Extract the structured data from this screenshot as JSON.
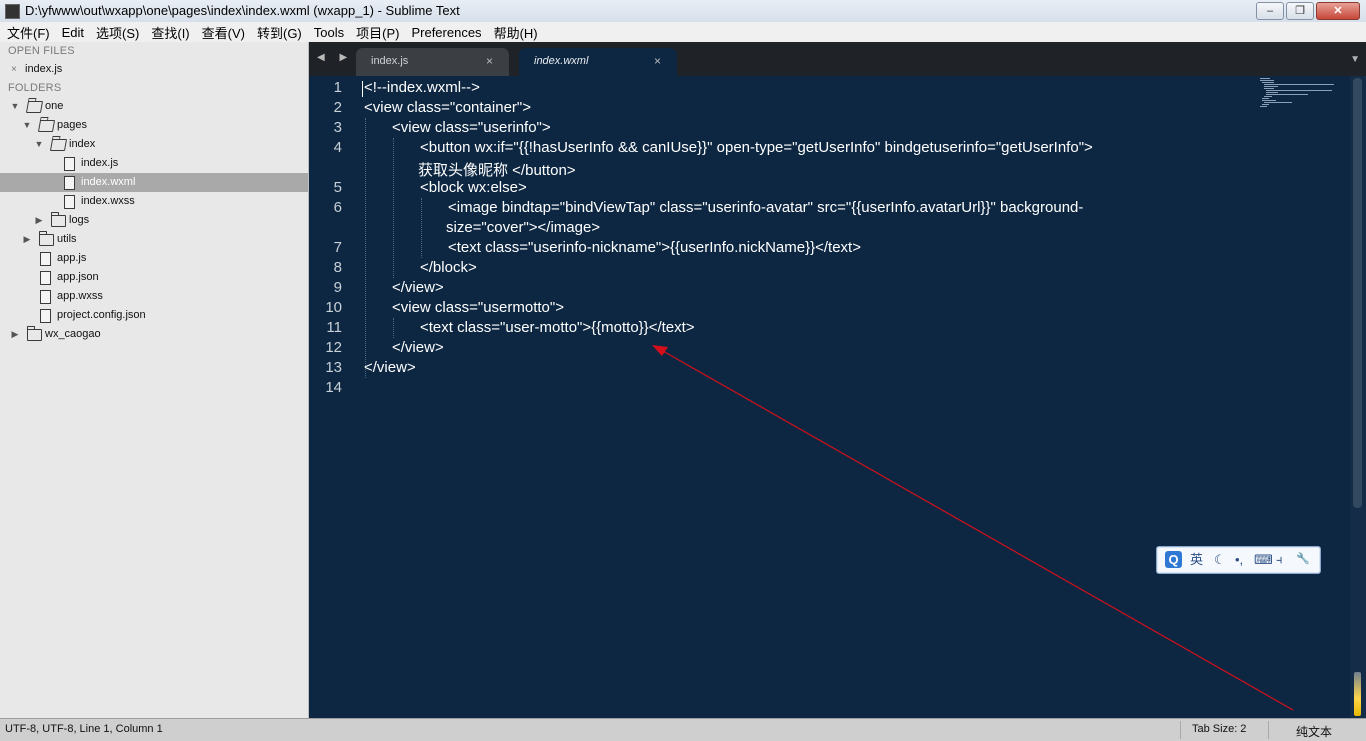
{
  "window": {
    "title": "D:\\yfwww\\out\\wxapp\\one\\pages\\index\\index.wxml (wxapp_1) - Sublime Text",
    "minimize": "‒",
    "maximize": "❐",
    "close": "✕"
  },
  "menu": [
    "文件(F)",
    "Edit",
    "选项(S)",
    "查找(I)",
    "查看(V)",
    "转到(G)",
    "Tools",
    "项目(P)",
    "Preferences",
    "帮助(H)"
  ],
  "sidebar": {
    "open_files_header": "OPEN FILES",
    "open_files": [
      {
        "close": "×",
        "name": "index.js"
      }
    ],
    "folders_header": "FOLDERS",
    "tree": [
      {
        "name": "one",
        "type": "folder",
        "expanded": true
      },
      {
        "name": "pages",
        "type": "folder",
        "expanded": true
      },
      {
        "name": "index",
        "type": "folder",
        "expanded": true
      },
      {
        "name": "index.js",
        "type": "file"
      },
      {
        "name": "index.wxml",
        "type": "file",
        "selected": true
      },
      {
        "name": "index.wxss",
        "type": "file"
      },
      {
        "name": "logs",
        "type": "folder",
        "expanded": false
      },
      {
        "name": "utils",
        "type": "folder",
        "expanded": false
      },
      {
        "name": "app.js",
        "type": "file"
      },
      {
        "name": "app.json",
        "type": "file"
      },
      {
        "name": "app.wxss",
        "type": "file"
      },
      {
        "name": "project.config.json",
        "type": "file"
      },
      {
        "name": "wx_caogao",
        "type": "folder",
        "expanded": false
      }
    ]
  },
  "tabs": [
    {
      "label": "index.js",
      "close": "×",
      "active": false
    },
    {
      "label": "index.wxml",
      "close": "×",
      "active": true
    }
  ],
  "tab_nav": "◀ ▶",
  "tab_menu": "▼",
  "editor": {
    "line_numbers": [
      "1",
      "2",
      "3",
      "4",
      "5",
      "6",
      "7",
      "8",
      "9",
      "10",
      "11",
      "12",
      "13",
      "14"
    ],
    "lines": [
      "<!--index.wxml-->",
      "<view class=\"container\">",
      "<view class=\"userinfo\">",
      "<button wx:if=\"{{!hasUserInfo && canIUse}}\" open-type=\"getUserInfo\" bindgetuserinfo=\"getUserInfo\">",
      "获取头像昵称 </button>",
      "<block wx:else>",
      "<image bindtap=\"bindViewTap\" class=\"userinfo-avatar\" src=\"{{userInfo.avatarUrl}}\" background-",
      "size=\"cover\"></image>",
      "<text class=\"userinfo-nickname\">{{userInfo.nickName}}</text>",
      "</block>",
      "</view>",
      "<view class=\"usermotto\">",
      "<text class=\"user-motto\">{{motto}}</text>",
      "</view>",
      "</view>"
    ],
    "background": "#0d2742",
    "annotation_color": "#d40f1b"
  },
  "ime_toolbar": {
    "logo": "Q",
    "mode": "英",
    "moon": "☾",
    "punct": "•,",
    "keyboard": "⌨",
    "split": "⫞",
    "settings": "🔧"
  },
  "status": {
    "position": "UTF-8, UTF-8, Line 1, Column 1",
    "tab_size": "Tab Size: 2",
    "syntax": "纯文本"
  }
}
